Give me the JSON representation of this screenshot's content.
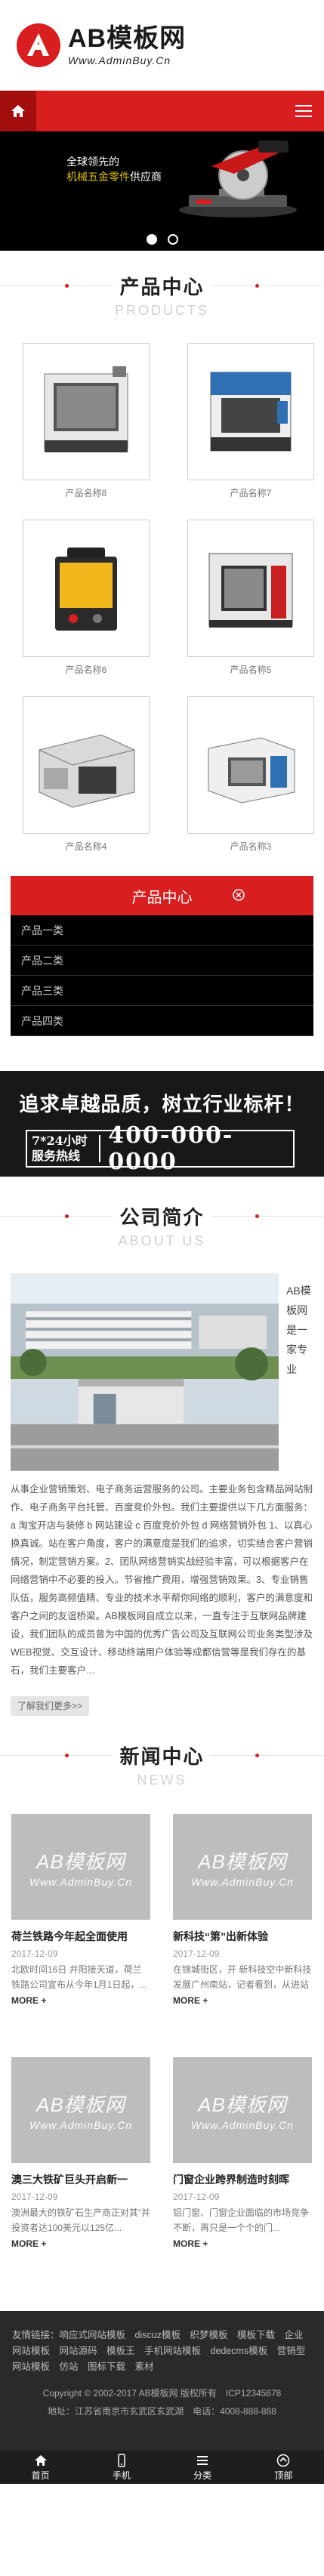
{
  "header": {
    "logo_name": "AB模板网",
    "logo_url": "Www.AdminBuy.Cn"
  },
  "banner": {
    "line1": "全球领先的",
    "line2_pre": "",
    "line2_hl": "机械五金零件",
    "line2_post": "供应商"
  },
  "products_section": {
    "title": "产品中心",
    "en": "PRODUCTS"
  },
  "products": [
    {
      "name": "产品名称8"
    },
    {
      "name": "产品名称7"
    },
    {
      "name": "产品名称6"
    },
    {
      "name": "产品名称5"
    },
    {
      "name": "产品名称4"
    },
    {
      "name": "产品名称3"
    }
  ],
  "category": {
    "title": "产品中心",
    "items": [
      "产品一类",
      "产品二类",
      "产品三类",
      "产品四类"
    ]
  },
  "hotline": {
    "slogan": "追求卓越品质，树立行业标杆！",
    "label1": "7*24小时",
    "label2": "服务热线",
    "number": "400-000-0000"
  },
  "about_section": {
    "title": "公司简介",
    "en": "ABOUT US"
  },
  "about": {
    "side": "AB模板网是一家专业",
    "text": "从事企业营销策划、电子商务运营服务的公司。主要业务包含精品网站制作、电子商务平台托管、百度竞价外包。我们主要提供以下几方面服务：a 淘宝开店与装修 b 网站建设 c 百度竞价外包 d 网络营销外包 1、以真心换真诚。站在客户角度，客户的满意度是我们的追求，切实结合客户营销情况，制定营销方案。2、团队网络营销实战经验丰富，可以根据客户在网络营销中不必要的投入。节省推广费用，增强营销效果。3、专业销售队伍，服务高频值精、专业的技术水平帮你网络的顺利，客户的满意度和客户之间的友谊桥梁。AB模板网自成立以来，一直专注于互联网品牌建设，我们团队的成员曾为中国的优秀广告公司及互联网公司业务类型涉及WEB视觉、交互设计、移动终端用户体验等成都信营等是我们存在的基石，我们主要客户…",
    "more": "了解我们更多>>"
  },
  "news_section": {
    "title": "新闻中心",
    "en": "NEWS"
  },
  "news": [
    {
      "img_w1": "AB模板网",
      "img_w2": "Www.AdminBuy.Cn",
      "title": "荷兰铁路今年起全面使用",
      "date": "2017-12-09",
      "summary": "北欧时间16日 井阳接天道，荷兰铁路公司宣布从今年1月1日起，...",
      "more": "MORE +"
    },
    {
      "img_w1": "AB模板网",
      "img_w2": "Www.AdminBuy.Cn",
      "title": "新科技“第”出新体验",
      "date": "2017-12-09",
      "summary": "在锦城街区，开 新科技空中新科技发展广州南站，记者看到，从进站口到候...",
      "more": "MORE +"
    },
    {
      "img_w1": "AB模板网",
      "img_w2": "Www.AdminBuy.Cn",
      "title": "澳三大铁矿巨头开启新一",
      "date": "2017-12-09",
      "summary": "澳洲最大的铁矿石生产商正对其“并投资者达100美元以125亿...",
      "more": "MORE +"
    },
    {
      "img_w1": "AB模板网",
      "img_w2": "Www.AdminBuy.Cn",
      "title": "门窗企业跨界制造时刻晖",
      "date": "2017-12-09",
      "summary": "铝门窗、门窗企业面临的市场竞争不断，再只是一个个的门...",
      "more": "MORE +"
    }
  ],
  "footer": {
    "links_label": "友情链接：",
    "links": "响应式网站模板　discuz模板　织梦模板　模板下载　企业网站模板　网站源码　模板王　手机网站模板　dedecms模板　营销型网站模板　仿站　图标下载　素材",
    "copyright": "Copyright © 2002-2017 AB模板网 版权所有　ICP12345678",
    "address": "地址：江苏省南京市玄武区玄武湖　电话：4008-888-888"
  },
  "bottom_nav": [
    "首页",
    "手机",
    "分类",
    "顶部"
  ],
  "colors": {
    "brand_red": "#d81e1e",
    "dark": "#181818",
    "hotline_yellow": "#e2c210"
  }
}
